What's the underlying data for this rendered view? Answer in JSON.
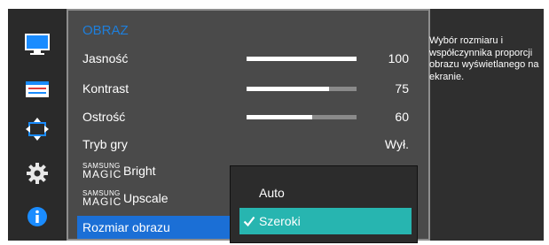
{
  "colors": {
    "accent_title": "#1e7fdc",
    "selected_row": "#1b6fd6",
    "active_option": "#27b5b0",
    "panel_bg": "#4a4a4a",
    "frame_bg": "#2f2f2f"
  },
  "sidebar": {
    "items": [
      {
        "icon": "monitor-icon"
      },
      {
        "icon": "settings-panel-icon"
      },
      {
        "icon": "resize-arrows-icon"
      },
      {
        "icon": "gear-icon"
      },
      {
        "icon": "info-icon"
      }
    ]
  },
  "menu": {
    "title": "OBRAZ",
    "items": [
      {
        "label": "Jasność",
        "value": "100",
        "level": 1.0
      },
      {
        "label": "Kontrast",
        "value": "75",
        "level": 0.75
      },
      {
        "label": "Ostrość",
        "value": "60",
        "level": 0.6
      },
      {
        "label": "Tryb gry",
        "value": "Wył."
      }
    ],
    "magic_bright": {
      "brand": "SAMSUNG",
      "magic": "MAGIC",
      "name": "Bright"
    },
    "magic_upscale": {
      "brand": "SAMSUNG",
      "magic": "MAGIC",
      "name": "Upscale"
    },
    "selected_item": "Rozmiar obrazu"
  },
  "submenu": {
    "options": [
      {
        "label": "Auto",
        "active": false
      },
      {
        "label": "Szeroki",
        "active": true
      }
    ]
  },
  "help": {
    "text": "Wybór rozmiaru i współczynnika proporcji obrazu wyświetlanego na ekranie."
  }
}
